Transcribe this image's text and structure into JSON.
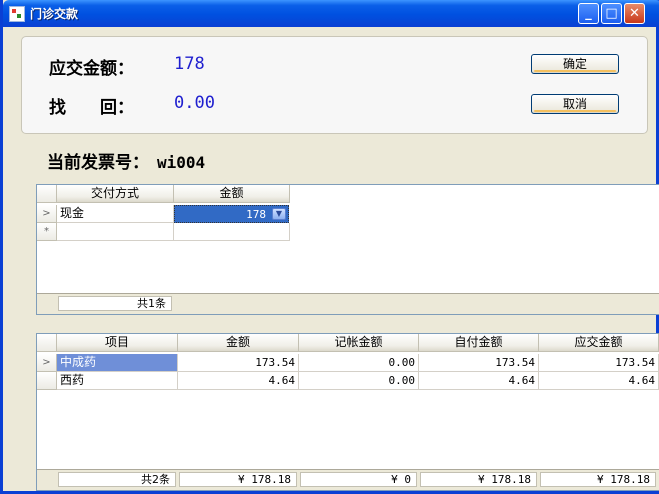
{
  "window": {
    "title": "门诊交款"
  },
  "payment": {
    "due_label": "应交金额：",
    "due_value": "178",
    "change_label": "找　　回：",
    "change_value": "0.00",
    "ok_label": "确定",
    "cancel_label": "取消"
  },
  "invoice": {
    "label": "当前发票号：",
    "number": "wi004"
  },
  "pay_grid": {
    "columns": [
      "交付方式",
      "金额"
    ],
    "rows": [
      {
        "method": "现金",
        "amount": "178"
      }
    ],
    "new_row_marker": "*",
    "footer_count": "共1条"
  },
  "item_grid": {
    "columns": [
      "项目",
      "金额",
      "记帐金额",
      "自付金额",
      "应交金额"
    ],
    "rows": [
      {
        "item": "中成药",
        "amount": "173.54",
        "charged": "0.00",
        "self_pay": "173.54",
        "due": "173.54"
      },
      {
        "item": "西药",
        "amount": "4.64",
        "charged": "0.00",
        "self_pay": "4.64",
        "due": "4.64"
      }
    ],
    "footer": {
      "count": "共2条",
      "amount": "¥ 178.18",
      "charged": "¥ 0",
      "self_pay": "¥ 178.18",
      "due": "¥ 178.18"
    }
  }
}
